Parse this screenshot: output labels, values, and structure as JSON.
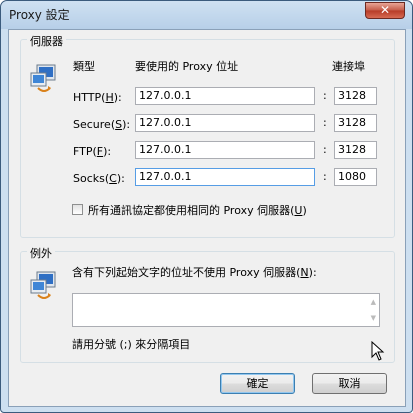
{
  "window": {
    "title": "Proxy 設定",
    "close_glyph": "✕"
  },
  "servers": {
    "group_label": "伺服器",
    "icon": "network-computer-icon",
    "col_type": "類型",
    "col_proxy": "要使用的 Proxy 位址",
    "col_port": "連接埠",
    "rows": [
      {
        "label": "HTTP",
        "mnemonic": "H",
        "address": "127.0.0.1",
        "port": "3128"
      },
      {
        "label": "Secure",
        "mnemonic": "S",
        "address": "127.0.0.1",
        "port": "3128"
      },
      {
        "label": "FTP",
        "mnemonic": "F",
        "address": "127.0.0.1",
        "port": "3128"
      },
      {
        "label": "Socks",
        "mnemonic": "C",
        "address": "127.0.0.1",
        "port": "1080"
      }
    ],
    "same_proxy_label": "所有通訊協定都使用相同的 Proxy 伺服器",
    "same_proxy_mnemonic": "U",
    "same_proxy_checked": false
  },
  "exceptions": {
    "group_label": "例外",
    "icon": "network-computer-icon",
    "label": "含有下列起始文字的位址不使用 Proxy 伺服器",
    "mnemonic": "N",
    "value": "",
    "hint": "請用分號 (;) 來分隔項目"
  },
  "buttons": {
    "ok": "確定",
    "cancel": "取消"
  }
}
